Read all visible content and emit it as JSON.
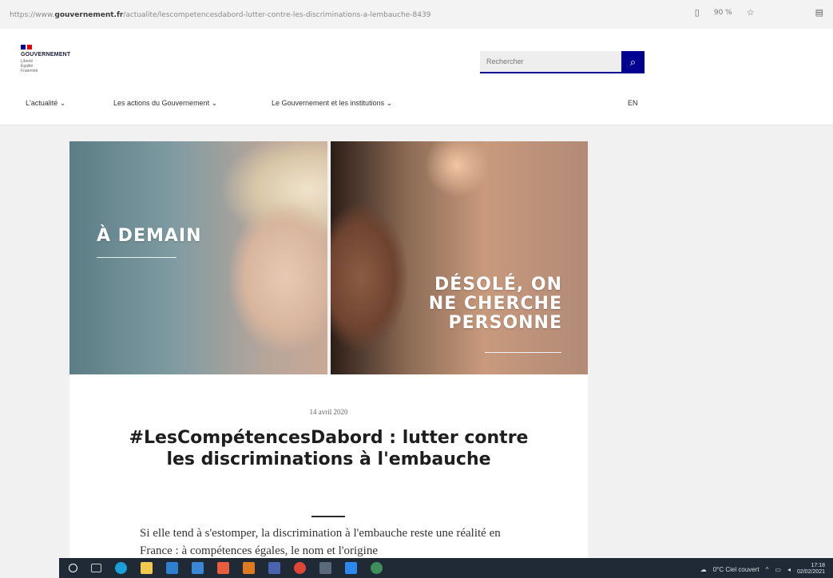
{
  "browser": {
    "url_prefix": "https://www.",
    "url_domain": "gouvernement.fr",
    "url_path": "/actualite/lescompetencesdabord-lutter-contre-les-discriminations-a-lembauche-8439",
    "zoom": "90 %",
    "icons": [
      "reader-mode-icon",
      "favorite-star-icon",
      "collections-icon"
    ]
  },
  "header": {
    "logo_text": "GOUVERNEMENT",
    "motto": [
      "Liberté",
      "Égalité",
      "Fraternité"
    ],
    "search_placeholder": "Rechercher",
    "nav": [
      {
        "label": "L'actualité ⌄"
      },
      {
        "label": "Les actions du Gouvernement ⌄"
      },
      {
        "label": "Le Gouvernement et les institutions ⌄"
      }
    ],
    "lang": "EN",
    "colors": {
      "primary": "#000091",
      "flag_blue": "#000091",
      "flag_red": "#e1000f"
    }
  },
  "hero": {
    "left_text": "À DEMAIN",
    "right_text_lines": [
      "DÉSOLÉ, ON",
      "NE CHERCHE",
      "PERSONNE"
    ]
  },
  "article": {
    "date": "14 avril 2020",
    "title": "#LesCompétencesDabord : lutter contre les discriminations à l'embauche",
    "lead": "Si elle tend à s'estomper, la discrimination à l'embauche reste une réalité en France : à compétences égales, le nom et l'origine"
  },
  "taskbar": {
    "weather": "0°C Ciel couvert",
    "time": "17:18",
    "date": "02/02/2021",
    "apps": [
      "search-icon",
      "task-view-icon",
      "edge-icon",
      "explorer-icon",
      "store-icon",
      "mail-icon",
      "photos-icon",
      "office-icon",
      "app-icon",
      "chrome-icon",
      "calculator-icon",
      "settings-icon",
      "vpn-icon"
    ]
  }
}
